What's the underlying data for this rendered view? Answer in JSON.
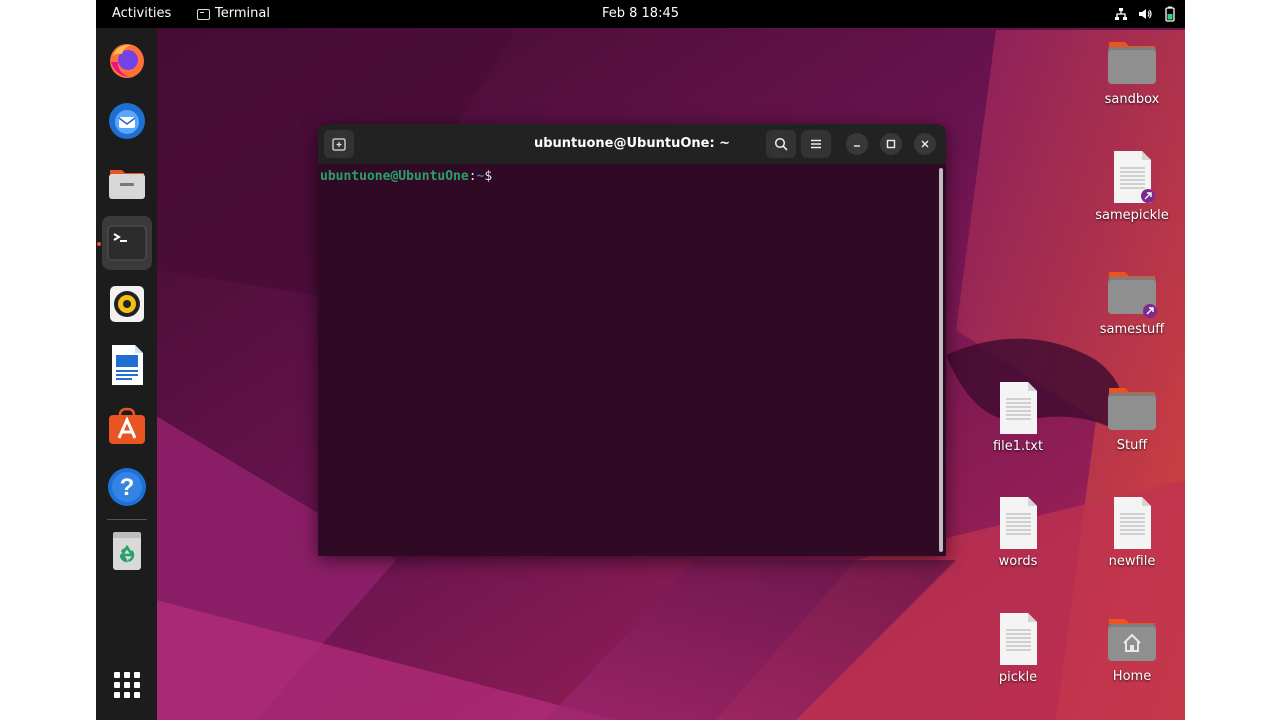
{
  "topbar": {
    "activities": "Activities",
    "app_name": "Terminal",
    "app_icon": "terminal-icon",
    "clock": "Feb 8  18:45",
    "status_icons": [
      "network-icon",
      "volume-icon",
      "battery-icon"
    ]
  },
  "dock": {
    "items": [
      {
        "name": "Firefox",
        "icon": "firefox-icon"
      },
      {
        "name": "Thunderbird",
        "icon": "thunderbird-icon"
      },
      {
        "name": "Files",
        "icon": "files-icon"
      },
      {
        "name": "Terminal",
        "icon": "terminal-icon",
        "active": true
      },
      {
        "name": "Rhythmbox",
        "icon": "rhythmbox-icon"
      },
      {
        "name": "LibreOffice Writer",
        "icon": "writer-icon"
      },
      {
        "name": "Ubuntu Software",
        "icon": "software-icon"
      },
      {
        "name": "Help",
        "icon": "help-icon"
      },
      {
        "name": "Trash",
        "icon": "trash-icon"
      },
      {
        "name": "Show Applications",
        "icon": "app-grid-icon"
      }
    ]
  },
  "terminal": {
    "title": "ubuntuone@UbuntuOne: ~",
    "prompt_user": "ubuntuone@UbuntuOne",
    "prompt_sep": ":",
    "prompt_path": "~",
    "prompt_symbol": "$",
    "buttons": [
      "new-tab-icon",
      "search-icon",
      "menu-icon",
      "minimize-icon",
      "maximize-icon",
      "close-icon"
    ]
  },
  "desktop": {
    "icons": [
      {
        "label": "sandbox",
        "type": "folder"
      },
      {
        "label": "samepickle",
        "type": "file-link"
      },
      {
        "label": "samestuff",
        "type": "folder-link"
      },
      {
        "label": "file1.txt",
        "type": "file"
      },
      {
        "label": "Stuff",
        "type": "folder"
      },
      {
        "label": "words",
        "type": "file"
      },
      {
        "label": "newfile",
        "type": "file"
      },
      {
        "label": "pickle",
        "type": "file"
      },
      {
        "label": "Home",
        "type": "home-folder"
      }
    ]
  },
  "colors": {
    "topbar": "#000000",
    "dock": "#1c1c1c",
    "terminal_bg": "#300a24",
    "prompt_user": "#26a269",
    "prompt_path": "#3a76d0",
    "accent": "#e95420"
  }
}
